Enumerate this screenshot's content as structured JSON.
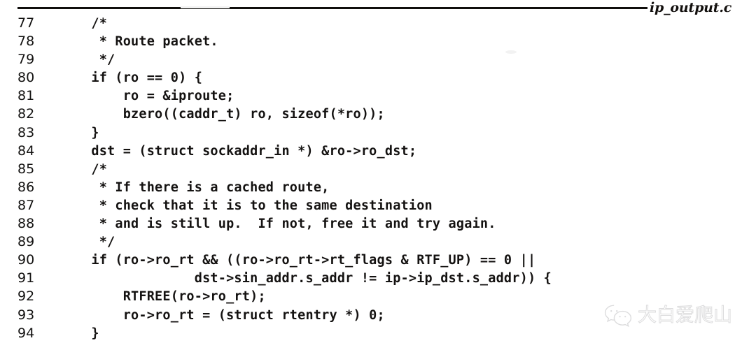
{
  "header": {
    "filename": "ip_output.c",
    "rule_icon": "horizontal-rule"
  },
  "listing": {
    "lines": [
      {
        "number": "77",
        "code": "    /*"
      },
      {
        "number": "78",
        "code": "     * Route packet."
      },
      {
        "number": "79",
        "code": "     */"
      },
      {
        "number": "80",
        "code": "    if (ro == 0) {"
      },
      {
        "number": "81",
        "code": "        ro = &iproute;"
      },
      {
        "number": "82",
        "code": "        bzero((caddr_t) ro, sizeof(*ro));"
      },
      {
        "number": "83",
        "code": "    }"
      },
      {
        "number": "84",
        "code": "    dst = (struct sockaddr_in *) &ro->ro_dst;"
      },
      {
        "number": "85",
        "code": "    /*"
      },
      {
        "number": "86",
        "code": "     * If there is a cached route,"
      },
      {
        "number": "87",
        "code": "     * check that it is to the same destination"
      },
      {
        "number": "88",
        "code": "     * and is still up.  If not, free it and try again."
      },
      {
        "number": "89",
        "code": "     */"
      },
      {
        "number": "90",
        "code": "    if (ro->ro_rt && ((ro->ro_rt->rt_flags & RTF_UP) == 0 ||"
      },
      {
        "number": "91",
        "code": "                 dst->sin_addr.s_addr != ip->ip_dst.s_addr)) {"
      },
      {
        "number": "92",
        "code": "        RTFREE(ro->ro_rt);"
      },
      {
        "number": "93",
        "code": "        ro->ro_rt = (struct rtentry *) 0;"
      },
      {
        "number": "94",
        "code": "    }"
      }
    ]
  },
  "watermark": {
    "logo_icon": "wechat-logo-icon",
    "text": "大白爱爬山"
  },
  "colors": {
    "ink": "#141211",
    "rule": "#100f0d",
    "page_background": "#ffffff",
    "watermark_stroke": "#8d8d90"
  }
}
